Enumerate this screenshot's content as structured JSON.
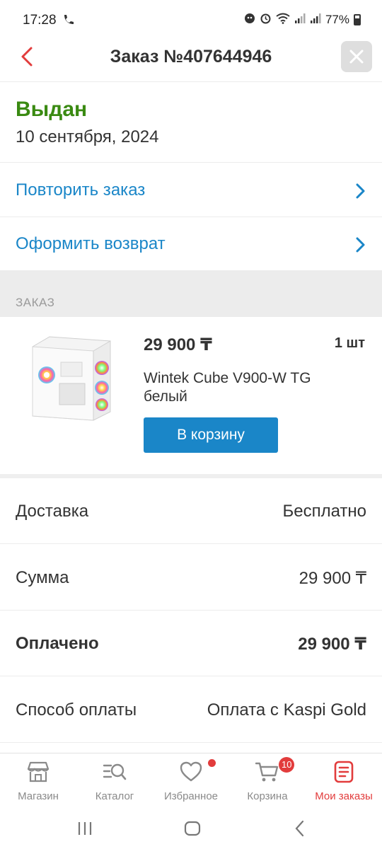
{
  "status_bar": {
    "time": "17:28",
    "battery": "77%",
    "icons": [
      "call-wifi-icon",
      "notification-icon",
      "alarm-icon",
      "wifi-icon",
      "signal-icon",
      "signal-icon",
      "battery-icon"
    ]
  },
  "header": {
    "title": "Заказ №407644946",
    "back_icon": "chevron-left-icon",
    "close_icon": "close-icon"
  },
  "order": {
    "status": "Выдан",
    "date": "10 сентября, 2024",
    "status_color": "#3a8a12"
  },
  "actions": [
    {
      "label": "Повторить заказ"
    },
    {
      "label": "Оформить возврат"
    }
  ],
  "section_label": "ЗАКАЗ",
  "product": {
    "price": "29 900 ₸",
    "quantity": "1 шт",
    "name": "Wintek Cube V900-W TG белый",
    "cart_button": "В корзину"
  },
  "summary": [
    {
      "key": "Доставка",
      "value": "Бесплатно"
    },
    {
      "key": "Сумма",
      "value": "29 900 ₸"
    },
    {
      "key": "Оплачено",
      "value": "29 900 ₸"
    },
    {
      "key": "Способ оплаты",
      "value": "Оплата с Kaspi Gold"
    }
  ],
  "bottom_nav": [
    {
      "label": "Магазин",
      "icon": "shop-icon"
    },
    {
      "label": "Каталог",
      "icon": "catalog-search-icon"
    },
    {
      "label": "Избранное",
      "icon": "heart-icon"
    },
    {
      "label": "Корзина",
      "icon": "cart-icon",
      "badge": "10"
    },
    {
      "label": "Мои заказы",
      "icon": "orders-icon",
      "active": true
    }
  ],
  "colors": {
    "accent_blue": "#1a86c8",
    "accent_red": "#e23c3c",
    "status_green": "#3a8a12"
  }
}
